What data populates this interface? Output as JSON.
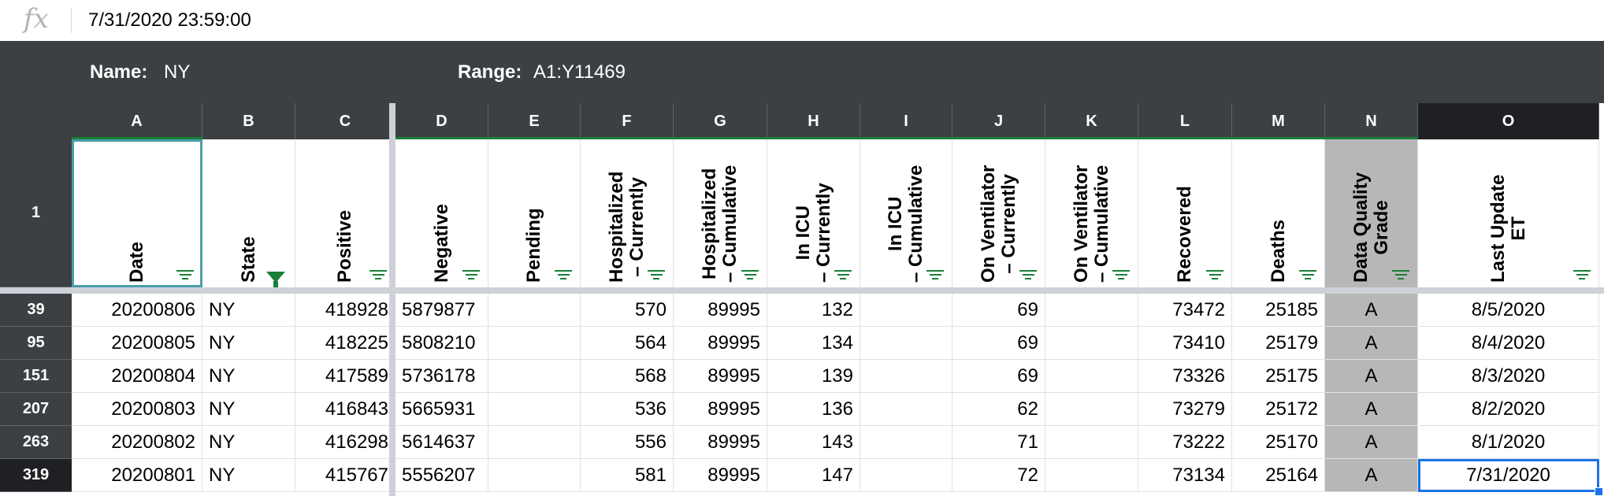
{
  "formula_bar": {
    "icon": "fx",
    "value": "7/31/2020 23:59:00"
  },
  "named_range": {
    "name_label": "Name:",
    "name_value": "NY",
    "range_label": "Range:",
    "range_value": "A1:Y11469"
  },
  "columns": [
    "A",
    "B",
    "C",
    "D",
    "E",
    "F",
    "G",
    "H",
    "I",
    "J",
    "K",
    "L",
    "M",
    "N",
    "O"
  ],
  "header_row_number": "1",
  "headers": [
    "Date",
    "State",
    "Positive",
    "Negative",
    "Pending",
    "Hospitalized\n– Currently",
    "Hospitalized\n– Cumulative",
    "In ICU\n– Currently",
    "In ICU\n– Cumulative",
    "On Ventilator\n– Currently",
    "On Ventilator\n– Cumulative",
    "Recovered",
    "Deaths",
    "Data Quality\nGrade",
    "Last Update\nET"
  ],
  "rows": [
    {
      "num": "39",
      "cells": [
        "20200806",
        "NY",
        "418928",
        "5879877",
        "",
        "570",
        "89995",
        "132",
        "",
        "69",
        "",
        "73472",
        "25185",
        "A",
        "8/5/2020"
      ]
    },
    {
      "num": "95",
      "cells": [
        "20200805",
        "NY",
        "418225",
        "5808210",
        "",
        "564",
        "89995",
        "134",
        "",
        "69",
        "",
        "73410",
        "25179",
        "A",
        "8/4/2020"
      ]
    },
    {
      "num": "151",
      "cells": [
        "20200804",
        "NY",
        "417589",
        "5736178",
        "",
        "568",
        "89995",
        "139",
        "",
        "69",
        "",
        "73326",
        "25175",
        "A",
        "8/3/2020"
      ]
    },
    {
      "num": "207",
      "cells": [
        "20200803",
        "NY",
        "416843",
        "5665931",
        "",
        "536",
        "89995",
        "136",
        "",
        "62",
        "",
        "73279",
        "25172",
        "A",
        "8/2/2020"
      ]
    },
    {
      "num": "263",
      "cells": [
        "20200802",
        "NY",
        "416298",
        "5614637",
        "",
        "556",
        "89995",
        "143",
        "",
        "71",
        "",
        "73222",
        "25170",
        "A",
        "8/1/2020"
      ]
    },
    {
      "num": "319",
      "cells": [
        "20200801",
        "NY",
        "415767",
        "5556207",
        "",
        "581",
        "89995",
        "147",
        "",
        "72",
        "",
        "73134",
        "25164",
        "A",
        "7/31/2020"
      ]
    }
  ],
  "colors": {
    "header_bg": "#3c4043",
    "selected_header_bg": "#1f2023",
    "filter_green": "#188038",
    "selection_blue": "#1a73e8",
    "grey_column": "#b7b7b7"
  },
  "filter_icons": {
    "default": "filter-lines-icon",
    "active": "filter-funnel-icon"
  }
}
